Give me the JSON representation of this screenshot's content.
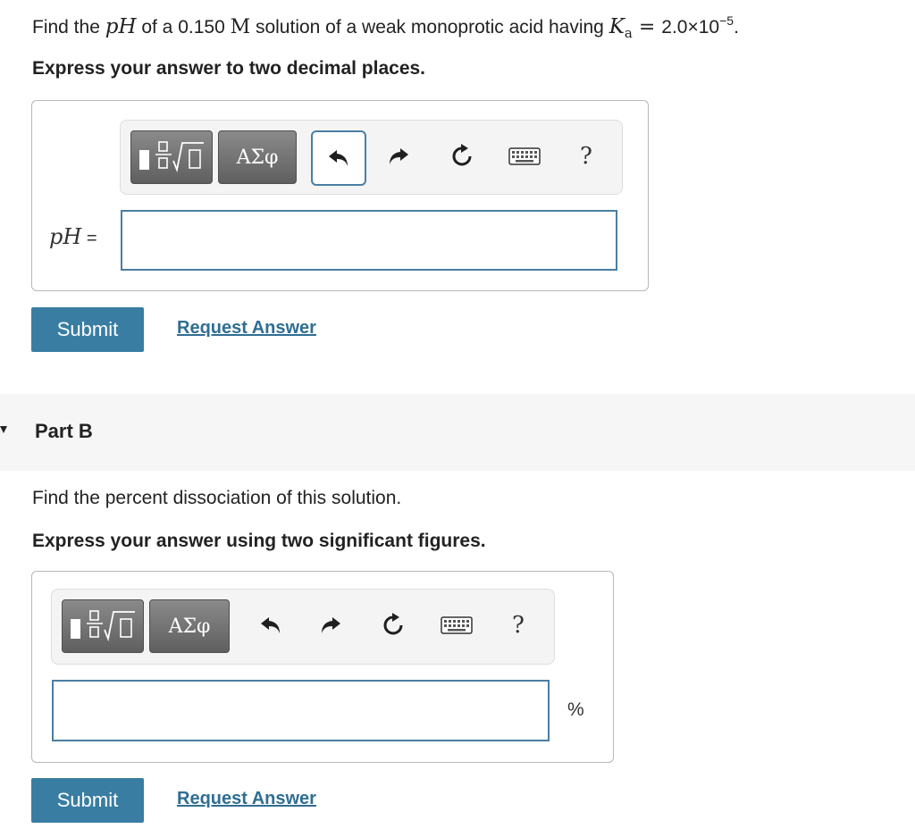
{
  "partA": {
    "question": {
      "pre": "Find the ",
      "ph_var": "pH",
      "mid1": " of a 0.150 ",
      "molar_unit": "M",
      "mid2": " solution of a weak monoprotic acid having ",
      "ka_var": "K",
      "ka_sub": "a",
      "ka_eq": " = ",
      "ka_value": "2.0×10",
      "ka_exp": "−5",
      "end": "."
    },
    "instruction": "Express your answer to two decimal places.",
    "toolbar": {
      "greek_label": "ΑΣφ",
      "help_label": "?"
    },
    "input": {
      "label_var": "pH",
      "label_eq": " =",
      "value": ""
    },
    "submit_label": "Submit",
    "request_label": "Request Answer"
  },
  "partB": {
    "title": "Part B",
    "question": "Find the percent dissociation of this solution.",
    "instruction": "Express your answer using two significant figures.",
    "toolbar": {
      "greek_label": "ΑΣφ",
      "help_label": "?"
    },
    "input": {
      "value": "",
      "unit": "%"
    },
    "submit_label": "Submit",
    "request_label": "Request Answer"
  },
  "icons": {
    "template": "fraction-sqrt-template-icon",
    "undo": "undo-icon",
    "redo": "redo-icon",
    "reset": "reset-icon",
    "keyboard": "keyboard-icon",
    "help": "help-icon"
  }
}
